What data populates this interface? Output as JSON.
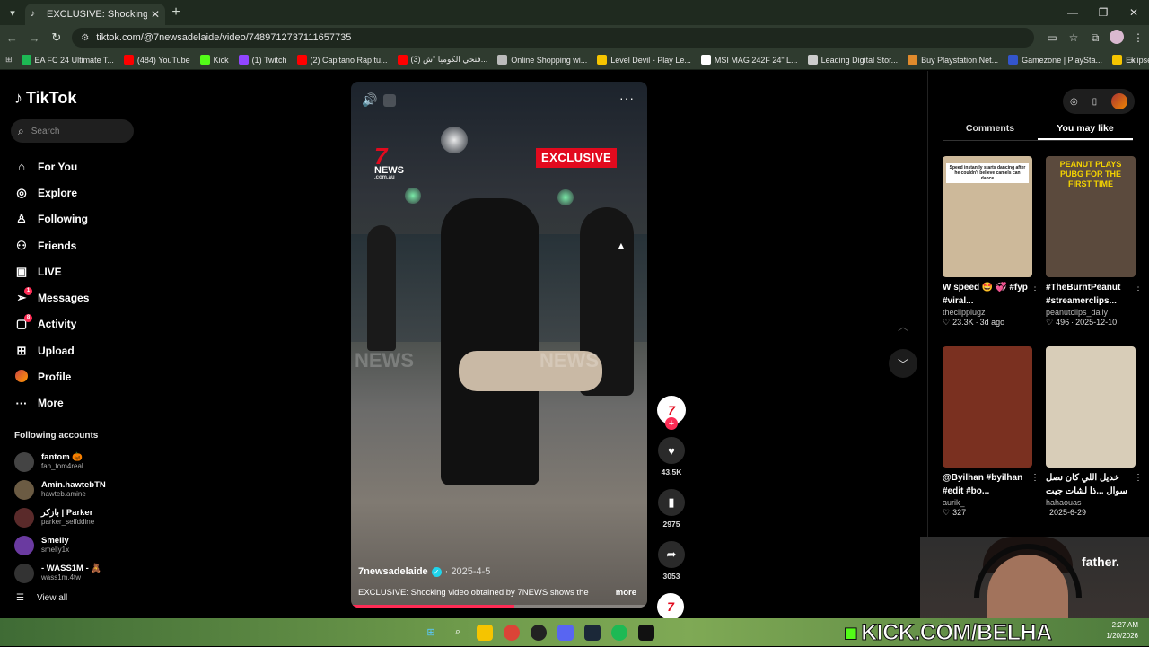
{
  "browser": {
    "tab_title": "EXCLUSIVE: Shocking video obtained",
    "url": "tiktok.com/@7newsadelaide/video/7489712737111657735",
    "bookmarks": [
      {
        "label": "EA FC 24 Ultimate T...",
        "color": "#1db954"
      },
      {
        "label": "(484) YouTube",
        "color": "#ff0000"
      },
      {
        "label": "Kick",
        "color": "#53fc18"
      },
      {
        "label": "(1) Twitch",
        "color": "#9146ff"
      },
      {
        "label": "(2) Capitano Rap tu...",
        "color": "#ff0000"
      },
      {
        "label": "(3) قنحي الكوميا \"ش...",
        "color": "#ff0000"
      },
      {
        "label": "Online Shopping wi...",
        "color": "#bbbbbb"
      },
      {
        "label": "Level Devil - Play Le...",
        "color": "#f5c400"
      },
      {
        "label": "MSI MAG 242F 24\" L...",
        "color": "#ffffff"
      },
      {
        "label": "Leading Digital Stor...",
        "color": "#cccccc"
      },
      {
        "label": "Buy Playstation Net...",
        "color": "#e08a2c"
      },
      {
        "label": "Gamezone | PlaySta...",
        "color": "#3355cc"
      },
      {
        "label": "Eklipse - Convert Tw...",
        "color": "#f5c400"
      }
    ]
  },
  "tiktok": {
    "logo": "TikTok",
    "search_placeholder": "Search",
    "nav": [
      {
        "label": "For You",
        "icon": "home-icon",
        "glyph": "⌂"
      },
      {
        "label": "Explore",
        "icon": "compass-icon",
        "glyph": "◎"
      },
      {
        "label": "Following",
        "icon": "following-icon",
        "glyph": "♙"
      },
      {
        "label": "Friends",
        "icon": "friends-icon",
        "glyph": "⚇"
      },
      {
        "label": "LIVE",
        "icon": "live-icon",
        "glyph": "▣"
      },
      {
        "label": "Messages",
        "icon": "messages-icon",
        "glyph": "➢",
        "badge": "1"
      },
      {
        "label": "Activity",
        "icon": "activity-icon",
        "glyph": "▢",
        "badge": "8"
      },
      {
        "label": "Upload",
        "icon": "upload-icon",
        "glyph": "⊞"
      },
      {
        "label": "Profile",
        "icon": "profile-icon",
        "glyph": ""
      },
      {
        "label": "More",
        "icon": "more-icon",
        "glyph": "···"
      }
    ],
    "following_title": "Following accounts",
    "following": [
      {
        "name": "fantom 🎃",
        "user": "fan_tom4real",
        "color": "#444"
      },
      {
        "name": "Amin.hawtebTN",
        "user": "hawteb.amine",
        "color": "#6b5b43"
      },
      {
        "name": "بازكر | Parker",
        "user": "parker_selfddine",
        "color": "#5a2a2a"
      },
      {
        "name": "Smelly",
        "user": "smelly1x",
        "color": "#6a3aa0"
      },
      {
        "name": "- WASS1M - 🧸",
        "user": "wass1m.4tw",
        "color": "#333"
      }
    ],
    "view_all": "View all"
  },
  "video": {
    "brand": "7",
    "brand_text": "NEWS",
    "brand_sub": ".com.au",
    "exclusive": "EXCLUSIVE",
    "watermark": "NEWS",
    "author": "7newsadelaide",
    "date": "2025-4-5",
    "description": "EXCLUSIVE: Shocking video obtained by 7NEWS shows the",
    "more": "more",
    "likes": "43.5K",
    "saves": "2975",
    "shares": "3053",
    "progress_fraction": 0.55
  },
  "right_panel": {
    "tabs": [
      "Comments",
      "You may like"
    ],
    "active_tab": "You may like",
    "cards": [
      {
        "title": "W speed 🤩 💞 #fyp #viral...",
        "user": "theclipplugz",
        "likes": "23.3K",
        "time": "3d ago",
        "thumb_text": "Speed instantly starts dancing after he couldn't believe camels can dance",
        "bg": "#cdb99a"
      },
      {
        "title": "#TheBurntPeanut #streamerclips...",
        "user": "peanutclips_daily",
        "likes": "496",
        "time": "2025-12-10",
        "thumb_text": "PEANUT PLAYS PUBG FOR THE FIRST TIME",
        "bg": "#5b4a3d"
      },
      {
        "title": "@Byilhan #byilhan #edit #bo...",
        "user": "aurik_",
        "likes": "327",
        "time": "",
        "thumb_text": "",
        "bg": "#7a3020"
      },
      {
        "title": "خديل اللي كان نصل سوال ...ذا لشات جيت بس ب",
        "user": "hahaouas",
        "likes": "",
        "time": "2025-6-29",
        "thumb_text": "",
        "bg": "#d8cdb8"
      }
    ]
  },
  "stream_overlay": {
    "kick_url": "KICK.COM/BELHA",
    "caption": "father.",
    "time": "2:27 AM",
    "date": "1/20/2026"
  }
}
